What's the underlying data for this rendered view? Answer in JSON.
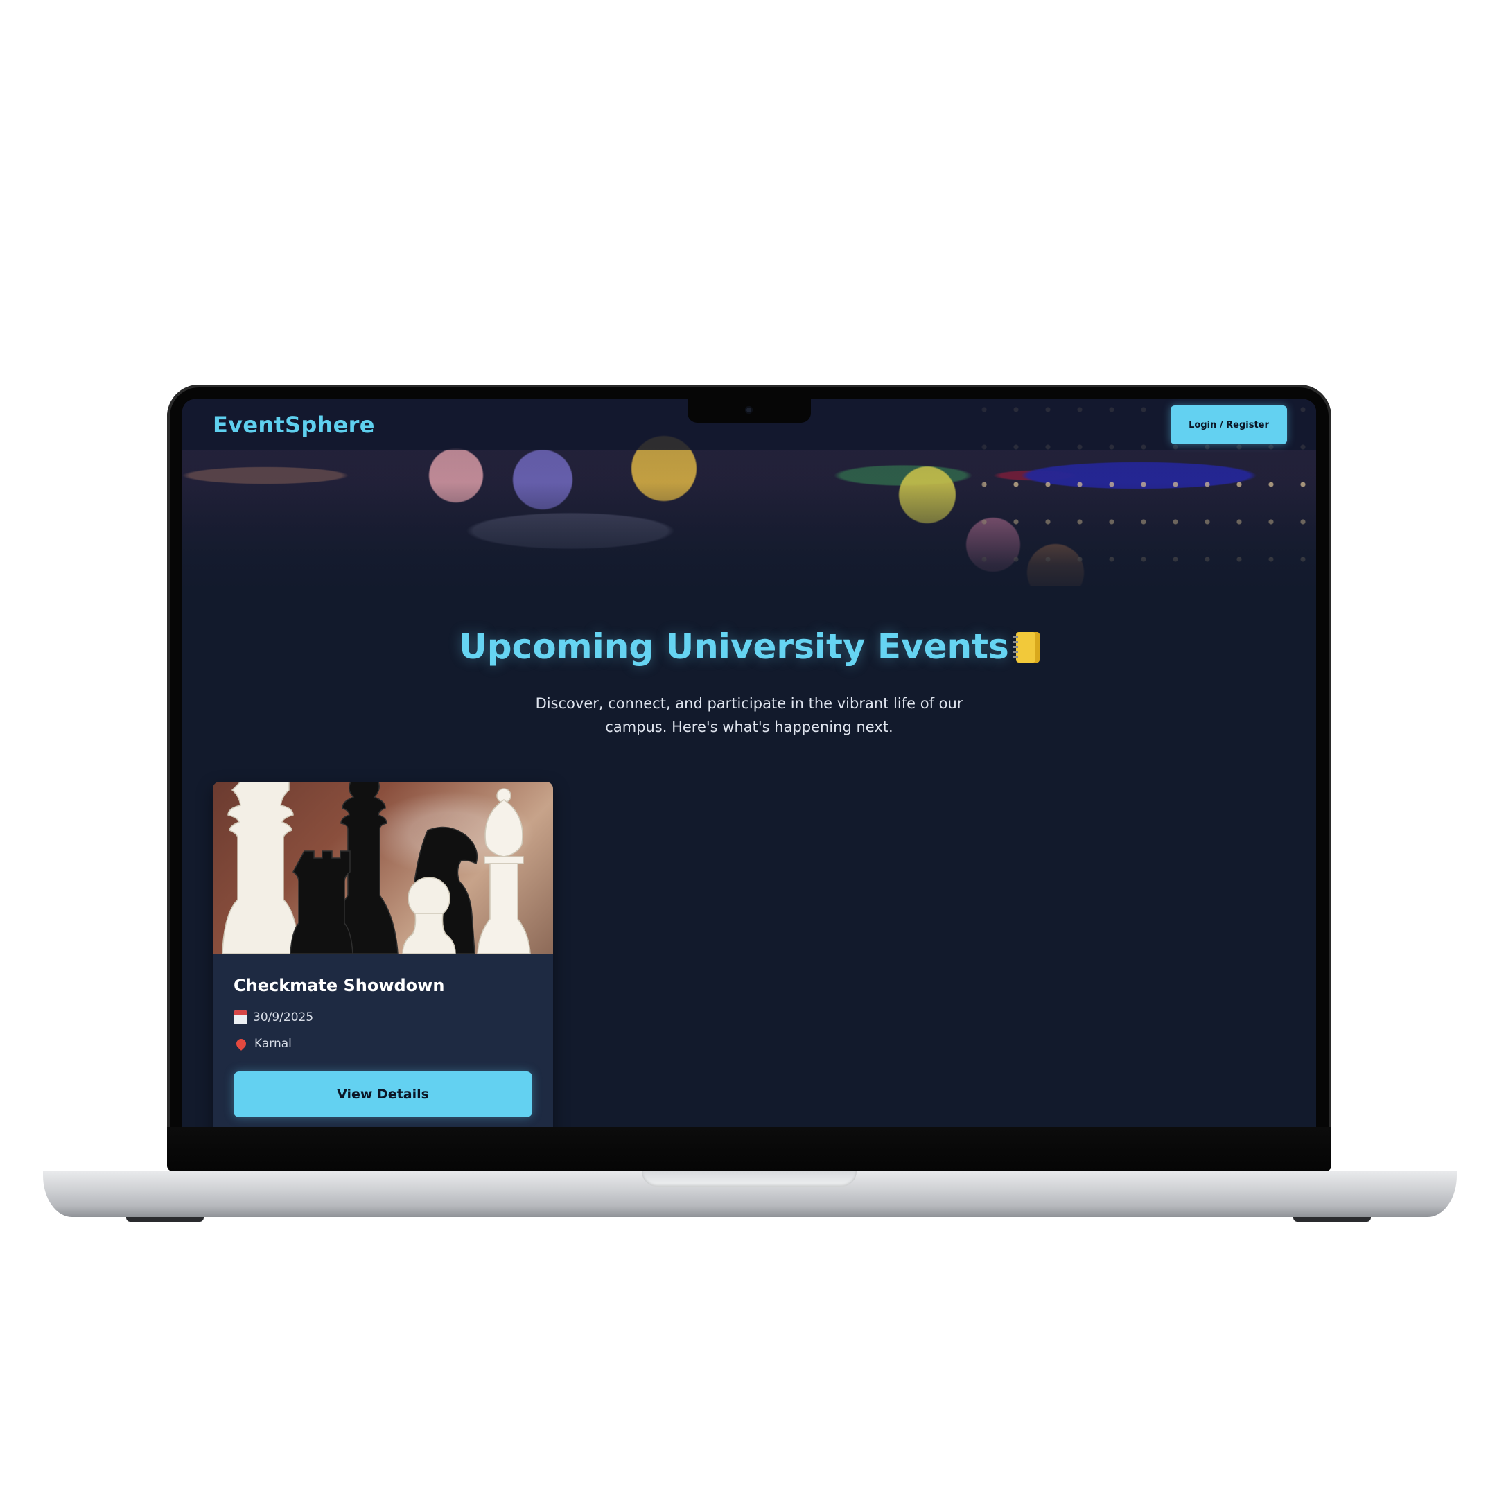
{
  "navbar": {
    "brand": "EventSphere",
    "login_label": "Login / Register"
  },
  "hero": {
    "title": "Upcoming University Events",
    "title_icon": "notebook-icon",
    "subtitle": "Discover, connect, and participate in the vibrant life of our campus. Here's what's happening next."
  },
  "events": [
    {
      "title": "Checkmate Showdown",
      "date": "30/9/2025",
      "location": "Karnal",
      "date_icon": "calendar-icon",
      "location_icon": "pin-icon",
      "button_label": "View Details",
      "image": "chess-pieces-photo"
    }
  ],
  "colors": {
    "accent": "#63d1f1",
    "background": "#121a2c",
    "card": "#1e2a42"
  }
}
